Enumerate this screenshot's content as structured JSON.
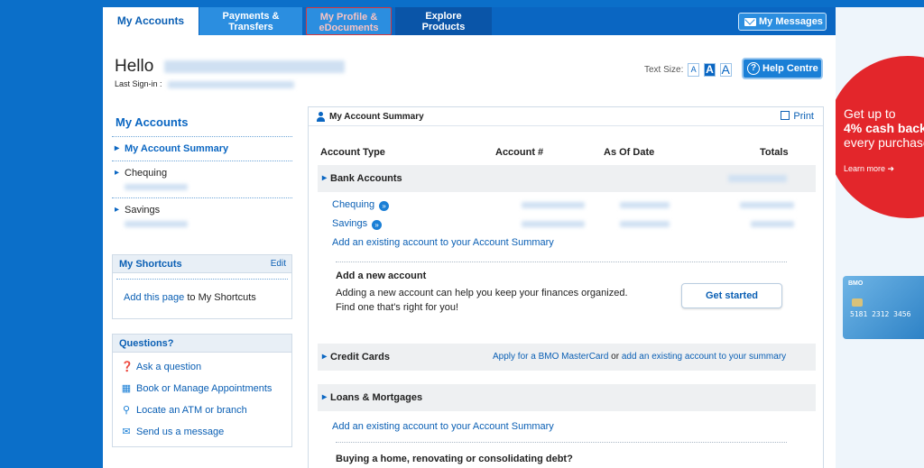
{
  "nav": {
    "tabs": [
      {
        "label": "My Accounts"
      },
      {
        "label": "Payments &\nTransfers"
      },
      {
        "label": "My Profile &\neDocuments"
      },
      {
        "label": "Explore\nProducts"
      }
    ],
    "messages_label": "My Messages"
  },
  "header": {
    "hello": "Hello",
    "last_signin_label": "Last Sign-in :",
    "text_size_label": "Text Size:",
    "text_size_options": [
      "A",
      "A",
      "A"
    ],
    "help_label": "Help Centre"
  },
  "sidebar": {
    "title": "My Accounts",
    "items": [
      {
        "label": "My Account Summary"
      },
      {
        "label": "Chequing"
      },
      {
        "label": "Savings"
      }
    ],
    "shortcuts": {
      "title": "My Shortcuts",
      "edit": "Edit",
      "add_link": "Add this page",
      "add_rest": " to My Shortcuts"
    },
    "questions": {
      "title": "Questions?",
      "items": [
        {
          "label": "Ask a question",
          "icon": "question-icon"
        },
        {
          "label": "Book or Manage Appointments",
          "icon": "calendar-icon"
        },
        {
          "label": "Locate an ATM or branch",
          "icon": "magnifier-icon"
        },
        {
          "label": "Send us a message",
          "icon": "envelope-icon"
        }
      ]
    }
  },
  "summary": {
    "title": "My Account Summary",
    "print": "Print",
    "columns": [
      "Account Type",
      "Account #",
      "As Of Date",
      "Totals"
    ],
    "bank": {
      "label": "Bank Accounts",
      "accounts": [
        {
          "name": "Chequing"
        },
        {
          "name": "Savings"
        }
      ],
      "add_existing": "Add an existing account to your Account Summary",
      "add_new_title": "Add a new account",
      "add_new_desc": "Adding a new account can help you keep your finances organized. Find one that's right for you!",
      "get_started": "Get started"
    },
    "credit": {
      "label": "Credit Cards",
      "apply": "Apply for a BMO MasterCard",
      "or": " or ",
      "add": "add an existing account to your summary"
    },
    "loans": {
      "label": "Loans & Mortgages",
      "add_existing": "Add an existing account to your Account Summary",
      "promo_title": "Buying a home, renovating or consolidating debt?"
    }
  },
  "ad": {
    "line1": "Get up to",
    "line2": "4% cash back",
    "line3": "every purchase",
    "learn_more": "Learn more",
    "card_brand": "BMO",
    "card_number": "5181 2312 3456"
  },
  "colors": {
    "brand_blue": "#0a66c2",
    "ad_red": "#e3262b",
    "section_gray": "#eef0f2"
  }
}
